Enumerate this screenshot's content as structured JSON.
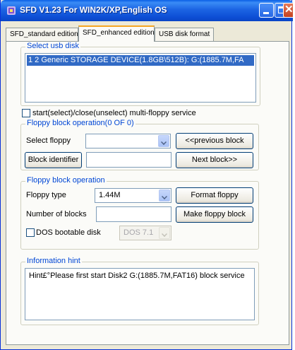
{
  "window": {
    "title": "SFD V1.23 For WIN2K/XP,English OS"
  },
  "tabs": [
    {
      "label": "SFD_standard edition"
    },
    {
      "label": "SFD_enhanced edition"
    },
    {
      "label": "USB disk format"
    }
  ],
  "active_tab": "SFD_enhanced edition",
  "usb_disk": {
    "group_label": "Select usb disk",
    "selected_item": "1 2 Generic STORAGE DEVICE(1.8GB\\512B): G:(1885.7M,FA"
  },
  "multi_floppy": {
    "label": "start(select)/close(unselect) multi-floppy service",
    "checked": false
  },
  "block_operation": {
    "group_label": "Floppy block operation(0 OF 0)",
    "select_floppy_label": "Select floppy",
    "select_floppy_value": "",
    "previous_button": "<<previous block",
    "identifier_button": "Block identifier",
    "identifier_value": "",
    "next_button": "Next block>>"
  },
  "floppy_operation": {
    "group_label": "Floppy block operation",
    "floppy_type_label": "Floppy type",
    "floppy_type_value": "1.44M",
    "format_button": "Format floppy",
    "number_of_blocks_label": "Number of blocks",
    "number_of_blocks_value": "",
    "make_button": "Make floppy block",
    "dos_bootable_label": "DOS bootable disk",
    "dos_bootable_checked": false,
    "dos_version_value": "DOS 7.1"
  },
  "information": {
    "group_label": "Information hint",
    "text": "Hint£°Please first start Disk2 G:(1885.7M,FAT16)   block service"
  },
  "colors": {
    "titlebar": "#0a5fe6",
    "group_label": "#0046d5",
    "selection": "#316ac5",
    "active_tab_accent": "#f5a623"
  },
  "icons": {
    "app": "sfd-app-icon",
    "minimize": "minimize-icon",
    "maximize": "maximize-icon",
    "close": "close-icon",
    "dropdown": "chevron-down-icon"
  }
}
